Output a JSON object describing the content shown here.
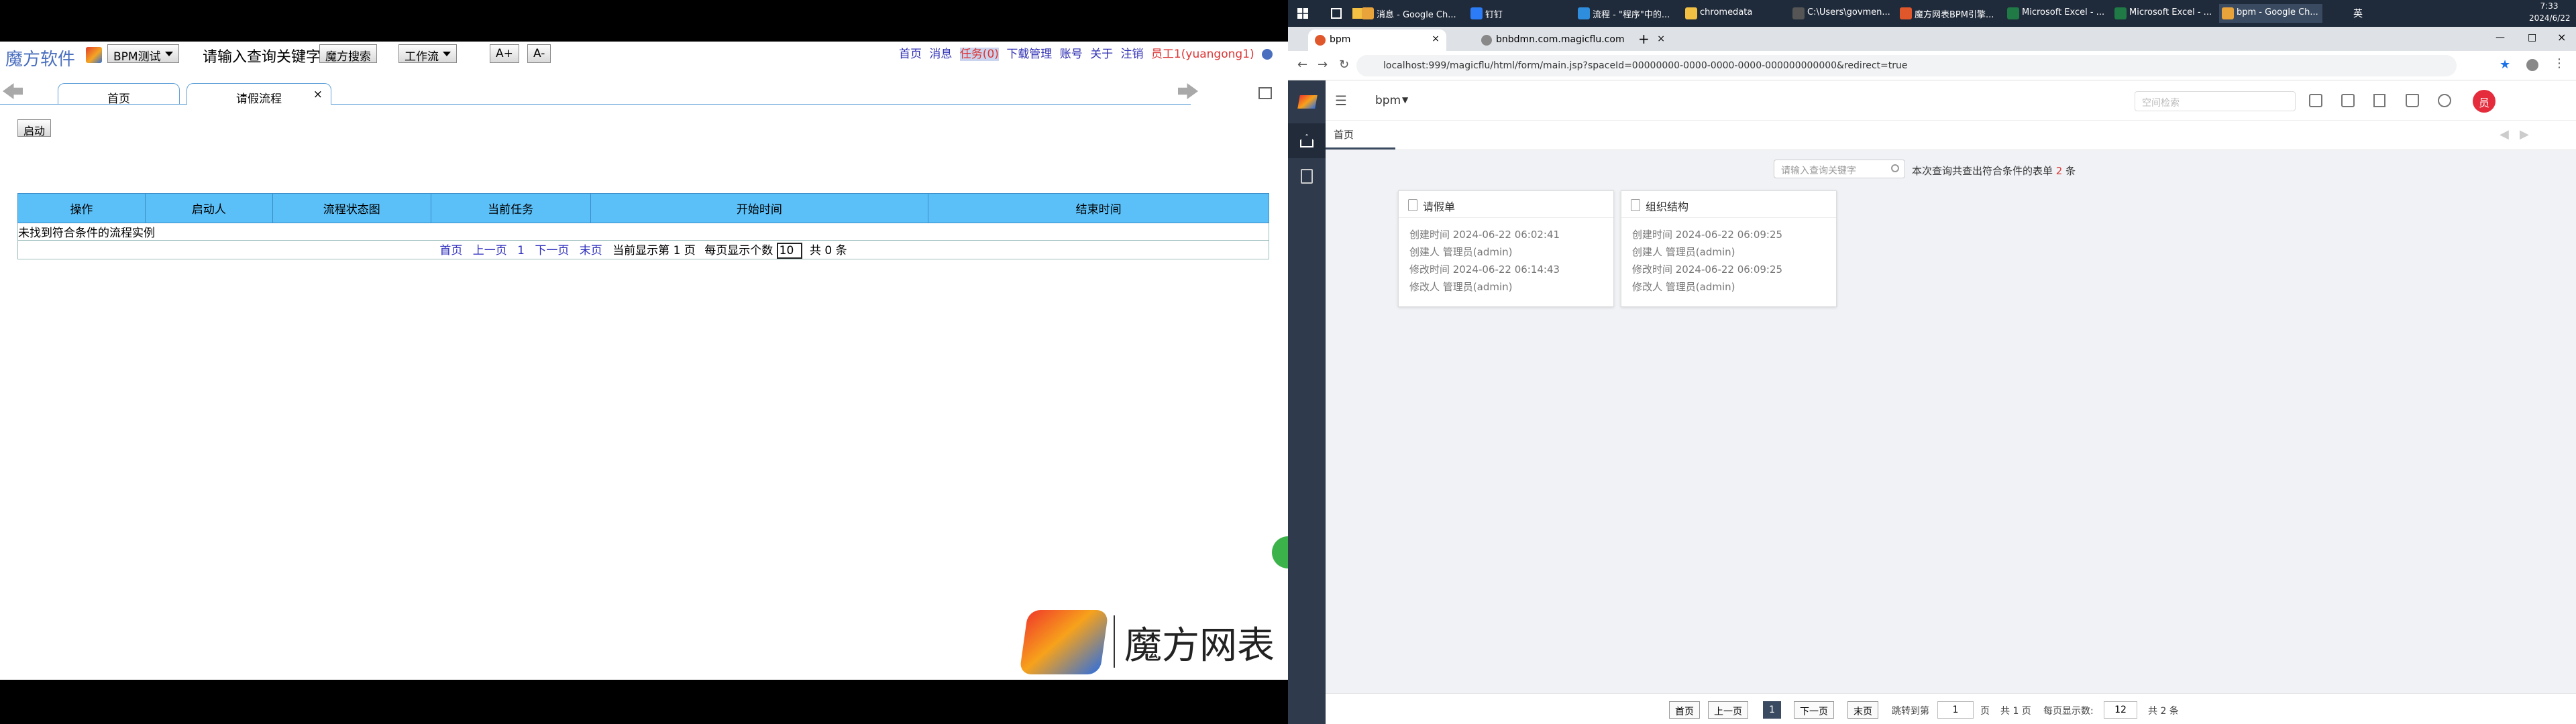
{
  "left": {
    "brand": "魔方软件",
    "dropdown1": "BPM测试",
    "search_keyword": "请输入查询关键字",
    "search_button": "魔方搜索",
    "dropdown2": "工作流",
    "font_plus": "A+",
    "font_minus": "A-",
    "topnav": {
      "home": "首页",
      "message": "消息",
      "task": "任务(0)",
      "download": "下载管理",
      "account": "账号",
      "about": "关于",
      "logout": "注销",
      "user": "员工1(yuangong1)"
    },
    "tabs": [
      {
        "label": "首页"
      },
      {
        "label": "请假流程",
        "close": "×"
      }
    ],
    "start_button": "启动",
    "table": {
      "headers": [
        "操作",
        "启动人",
        "流程状态图",
        "当前任务",
        "开始时间",
        "结束时间"
      ],
      "empty_text": "未找到符合条件的流程实例"
    },
    "pager": {
      "first": "首页",
      "prev": "上一页",
      "page": "1",
      "next": "下一页",
      "last": "末页",
      "current": "当前显示第 1 页",
      "per_page_label": "每页显示个数",
      "per_page_value": "10",
      "total": "共 0 条"
    },
    "mofang_logo": "魔方网表"
  },
  "right": {
    "taskbar": {
      "items": [
        {
          "label": "消息 - Google Ch...",
          "color": "#e8a33b"
        },
        {
          "label": "钉钉",
          "color": "#2b7cf6"
        },
        {
          "label": "流程 - \"程序\"中的...",
          "color": "#2f8dde"
        },
        {
          "label": "chromedata",
          "color": "#f2c043"
        },
        {
          "label": "C:\\Users\\govmen...",
          "color": "#555555"
        },
        {
          "label": "魔方网表BPM引擎...",
          "color": "#e0572c"
        },
        {
          "label": "Microsoft Excel - ...",
          "color": "#1f7a45"
        },
        {
          "label": "Microsoft Excel - ...",
          "color": "#1f7a45"
        },
        {
          "label": "bpm - Google Ch...",
          "color": "#e8a33b"
        }
      ],
      "time": "7:33",
      "date": "2024/6/22",
      "lang": "英"
    },
    "browser": {
      "tabs": [
        {
          "label": "bpm",
          "color": "#e0572c",
          "close": "×"
        },
        {
          "label": "bnbdmn.com.magicflu.com",
          "color": "#888888",
          "close": "×"
        }
      ],
      "new_tab": "+",
      "url": "localhost:999/magicflu/html/form/main.jsp?spaceId=00000000-0000-0000-0000-000000000000&redirect=true"
    },
    "header": {
      "app_name": "bpm",
      "search_placeholder": "空间检索",
      "avatar": "员"
    },
    "breadcrumb": "首页",
    "search": {
      "placeholder": "请输入查询关键字",
      "result_prefix": "本次查询共查出符合条件的表单",
      "result_count": "2",
      "result_suffix": "条"
    },
    "cards": [
      {
        "title": "请假单",
        "created": "创建时间 2024-06-22 06:02:41",
        "creator": "创建人 管理员(admin)",
        "modified": "修改时间 2024-06-22 06:14:43",
        "modifier": "修改人 管理员(admin)"
      },
      {
        "title": "组织结构",
        "created": "创建时间 2024-06-22 06:09:25",
        "creator": "创建人 管理员(admin)",
        "modified": "修改时间 2024-06-22 06:09:25",
        "modifier": "修改人 管理员(admin)"
      }
    ],
    "pager": {
      "first": "首页",
      "prev": "上一页",
      "page": "1",
      "next": "下一页",
      "last": "末页",
      "jump_label": "跳转到第",
      "jump_value": "1",
      "page_unit": "页",
      "total_pages": "共 1 页",
      "per_page_label": "每页显示数:",
      "per_page_value": "12",
      "total": "共 2 条"
    }
  }
}
